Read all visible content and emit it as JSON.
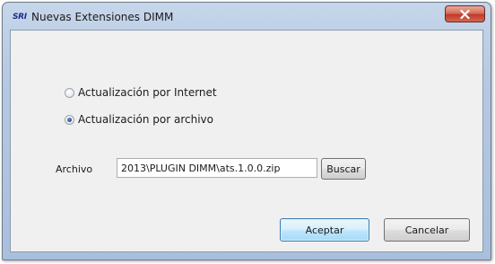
{
  "window": {
    "app_icon_text": "SRI",
    "title": "Nuevas Extensiones DIMM"
  },
  "titlebar": {
    "close_icon": "close-icon"
  },
  "options": {
    "internet_label": "Actualización por Internet",
    "internet_selected": false,
    "archivo_label": "Actualización por archivo",
    "archivo_selected": true
  },
  "file": {
    "label": "Archivo",
    "value": "2013\\PLUGIN DIMM\\ats.1.0.0.zip",
    "browse_label": "Buscar"
  },
  "footer": {
    "accept_label": "Aceptar",
    "cancel_label": "Cancelar"
  },
  "colors": {
    "titlebar": "#b6c9e2",
    "close_button": "#c0392b",
    "client_background": "#f0f0f0",
    "default_button_border": "#3c7fb1"
  }
}
